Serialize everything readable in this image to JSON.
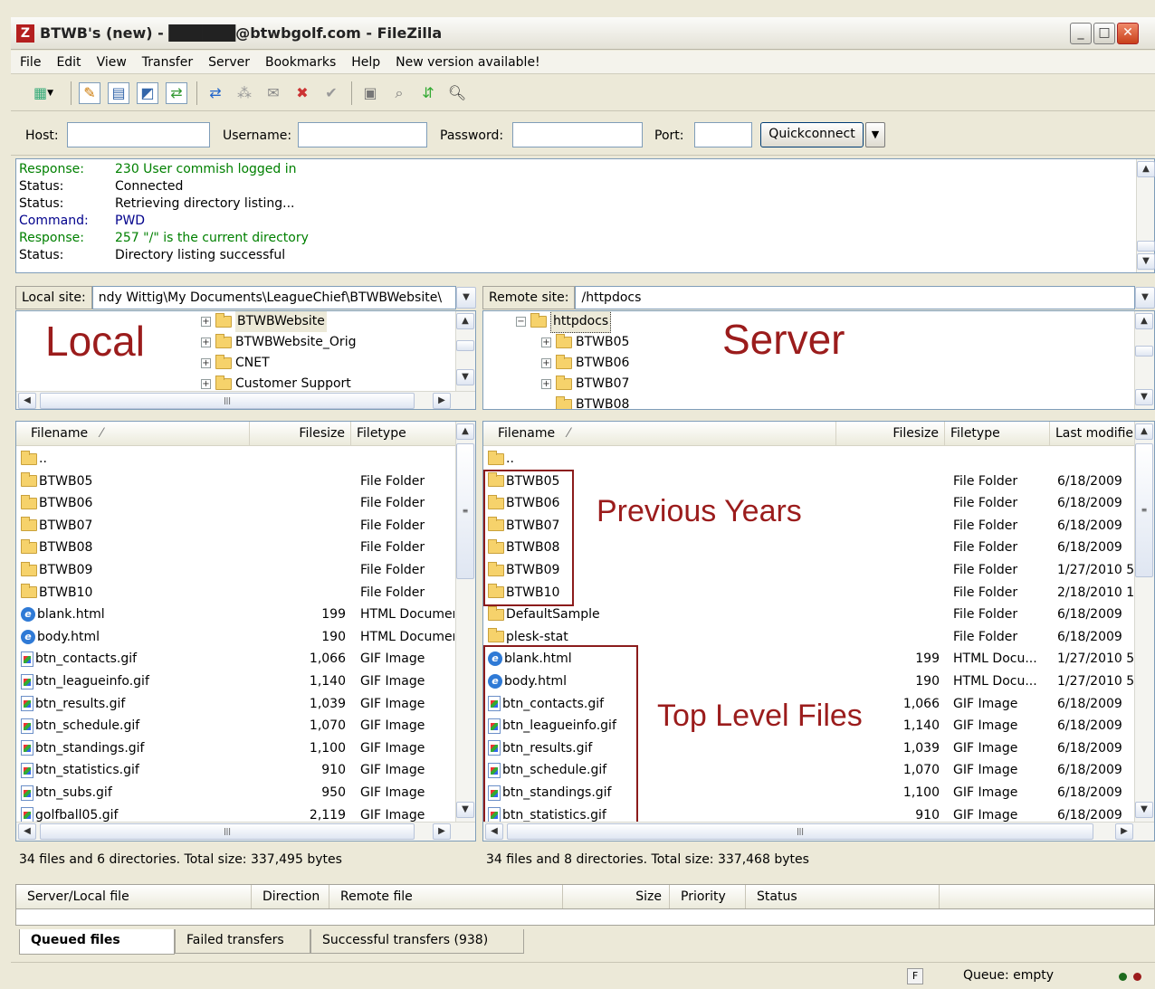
{
  "window": {
    "title": "BTWB's (new) - ██████@btwbgolf.com - FileZilla",
    "app_icon": "Z"
  },
  "menu": [
    "File",
    "Edit",
    "View",
    "Transfer",
    "Server",
    "Bookmarks",
    "Help",
    "New version available!"
  ],
  "quickconnect": {
    "host_label": "Host:",
    "username_label": "Username:",
    "password_label": "Password:",
    "port_label": "Port:",
    "button_label": "Quickconnect",
    "host_value": "",
    "username_value": "",
    "password_value": "",
    "port_value": ""
  },
  "log": [
    {
      "type": "Response:",
      "text": "230 User commish logged in",
      "color": "#008000"
    },
    {
      "type": "Status:",
      "text": "Connected",
      "color": "#000000"
    },
    {
      "type": "Status:",
      "text": "Retrieving directory listing...",
      "color": "#000000"
    },
    {
      "type": "Command:",
      "text": "PWD",
      "color": "#00008b"
    },
    {
      "type": "Response:",
      "text": "257 \"/\" is the current directory",
      "color": "#008000"
    },
    {
      "type": "Status:",
      "text": "Directory listing successful",
      "color": "#000000"
    }
  ],
  "local": {
    "site_label": "Local site:",
    "path": "ndy Wittig\\My Documents\\LeagueChief\\BTWBWebsite\\",
    "annotation": "Local",
    "tree": [
      "BTWBWebsite",
      "BTWBWebsite_Orig",
      "CNET",
      "Customer Support"
    ],
    "headers": {
      "name": "Filename",
      "size": "Filesize",
      "type": "Filetype"
    },
    "files": [
      {
        "name": "..",
        "size": "",
        "type": "",
        "icon": "folder"
      },
      {
        "name": "BTWB05",
        "size": "",
        "type": "File Folder",
        "icon": "folder"
      },
      {
        "name": "BTWB06",
        "size": "",
        "type": "File Folder",
        "icon": "folder"
      },
      {
        "name": "BTWB07",
        "size": "",
        "type": "File Folder",
        "icon": "folder"
      },
      {
        "name": "BTWB08",
        "size": "",
        "type": "File Folder",
        "icon": "folder"
      },
      {
        "name": "BTWB09",
        "size": "",
        "type": "File Folder",
        "icon": "folder"
      },
      {
        "name": "BTWB10",
        "size": "",
        "type": "File Folder",
        "icon": "folder"
      },
      {
        "name": "blank.html",
        "size": "199",
        "type": "HTML Documer",
        "icon": "html"
      },
      {
        "name": "body.html",
        "size": "190",
        "type": "HTML Documer",
        "icon": "html"
      },
      {
        "name": "btn_contacts.gif",
        "size": "1,066",
        "type": "GIF Image",
        "icon": "gif"
      },
      {
        "name": "btn_leagueinfo.gif",
        "size": "1,140",
        "type": "GIF Image",
        "icon": "gif"
      },
      {
        "name": "btn_results.gif",
        "size": "1,039",
        "type": "GIF Image",
        "icon": "gif"
      },
      {
        "name": "btn_schedule.gif",
        "size": "1,070",
        "type": "GIF Image",
        "icon": "gif"
      },
      {
        "name": "btn_standings.gif",
        "size": "1,100",
        "type": "GIF Image",
        "icon": "gif"
      },
      {
        "name": "btn_statistics.gif",
        "size": "910",
        "type": "GIF Image",
        "icon": "gif"
      },
      {
        "name": "btn_subs.gif",
        "size": "950",
        "type": "GIF Image",
        "icon": "gif"
      },
      {
        "name": "golfball05.gif",
        "size": "2,119",
        "type": "GIF Image",
        "icon": "gif"
      }
    ],
    "summary": "34 files and 6 directories. Total size: 337,495 bytes"
  },
  "remote": {
    "site_label": "Remote site:",
    "path": "/httpdocs",
    "annotation": "Server",
    "tree_root": "httpdocs",
    "tree": [
      "BTWB05",
      "BTWB06",
      "BTWB07",
      "BTWB08"
    ],
    "headers": {
      "name": "Filename",
      "size": "Filesize",
      "type": "Filetype",
      "modified": "Last modifie"
    },
    "files": [
      {
        "name": "..",
        "size": "",
        "type": "",
        "modified": "",
        "icon": "folder"
      },
      {
        "name": "BTWB05",
        "size": "",
        "type": "File Folder",
        "modified": "6/18/2009",
        "icon": "folder"
      },
      {
        "name": "BTWB06",
        "size": "",
        "type": "File Folder",
        "modified": "6/18/2009",
        "icon": "folder"
      },
      {
        "name": "BTWB07",
        "size": "",
        "type": "File Folder",
        "modified": "6/18/2009",
        "icon": "folder"
      },
      {
        "name": "BTWB08",
        "size": "",
        "type": "File Folder",
        "modified": "6/18/2009",
        "icon": "folder"
      },
      {
        "name": "BTWB09",
        "size": "",
        "type": "File Folder",
        "modified": "1/27/2010 5",
        "icon": "folder"
      },
      {
        "name": "BTWB10",
        "size": "",
        "type": "File Folder",
        "modified": "2/18/2010 1",
        "icon": "folder"
      },
      {
        "name": "DefaultSample",
        "size": "",
        "type": "File Folder",
        "modified": "6/18/2009",
        "icon": "folder"
      },
      {
        "name": "plesk-stat",
        "size": "",
        "type": "File Folder",
        "modified": "6/18/2009",
        "icon": "folder"
      },
      {
        "name": "blank.html",
        "size": "199",
        "type": "HTML Docu...",
        "modified": "1/27/2010 5",
        "icon": "html"
      },
      {
        "name": "body.html",
        "size": "190",
        "type": "HTML Docu...",
        "modified": "1/27/2010 5",
        "icon": "html"
      },
      {
        "name": "btn_contacts.gif",
        "size": "1,066",
        "type": "GIF Image",
        "modified": "6/18/2009",
        "icon": "gif"
      },
      {
        "name": "btn_leagueinfo.gif",
        "size": "1,140",
        "type": "GIF Image",
        "modified": "6/18/2009",
        "icon": "gif"
      },
      {
        "name": "btn_results.gif",
        "size": "1,039",
        "type": "GIF Image",
        "modified": "6/18/2009",
        "icon": "gif"
      },
      {
        "name": "btn_schedule.gif",
        "size": "1,070",
        "type": "GIF Image",
        "modified": "6/18/2009",
        "icon": "gif"
      },
      {
        "name": "btn_standings.gif",
        "size": "1,100",
        "type": "GIF Image",
        "modified": "6/18/2009",
        "icon": "gif"
      },
      {
        "name": "btn_statistics.gif",
        "size": "910",
        "type": "GIF Image",
        "modified": "6/18/2009",
        "icon": "gif"
      }
    ],
    "summary": "34 files and 8 directories. Total size: 337,468 bytes",
    "annotation_previous": "Previous Years",
    "annotation_toplevel": "Top Level Files"
  },
  "queue": {
    "headers": [
      "Server/Local file",
      "Direction",
      "Remote file",
      "Size",
      "Priority",
      "Status"
    ],
    "tabs": [
      "Queued files",
      "Failed transfers",
      "Successful transfers (938)"
    ]
  },
  "statusbar": {
    "queue": "Queue: empty"
  },
  "colors": {
    "annotation": "#9b1c1c",
    "accent": "#7f9db9"
  }
}
